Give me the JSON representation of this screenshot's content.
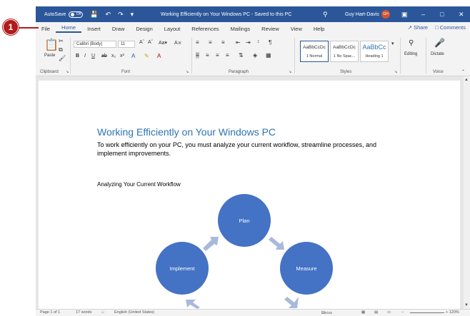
{
  "callout": {
    "number": "1"
  },
  "titlebar": {
    "autosave_label": "AutoSave",
    "autosave_state": "Off",
    "doc_title": "Working Efficiently on Your Windows PC  -  Saved to this PC",
    "user_name": "Guy Hart-Davis",
    "avatar_initials": "GH"
  },
  "tabs": [
    {
      "label": "File"
    },
    {
      "label": "Home"
    },
    {
      "label": "Insert"
    },
    {
      "label": "Draw"
    },
    {
      "label": "Design"
    },
    {
      "label": "Layout"
    },
    {
      "label": "References"
    },
    {
      "label": "Mailings"
    },
    {
      "label": "Review"
    },
    {
      "label": "View"
    },
    {
      "label": "Help"
    }
  ],
  "tab_actions": {
    "share": "Share",
    "comments": "Comments"
  },
  "ribbon": {
    "clipboard": {
      "label": "Clipboard",
      "paste": "Paste"
    },
    "font": {
      "label": "Font",
      "family": "Calibri (Body)",
      "size": "11"
    },
    "paragraph": {
      "label": "Paragraph"
    },
    "styles": {
      "label": "Styles",
      "items": [
        {
          "sample": "AaBbCcDc",
          "name": "1 Normal"
        },
        {
          "sample": "AaBbCcDc",
          "name": "1 No Spac..."
        },
        {
          "sample": "AaBbCc",
          "name": "Heading 1"
        }
      ]
    },
    "editing": {
      "label": "Editing"
    },
    "voice": {
      "label": "Voice",
      "dictate": "Dictate"
    }
  },
  "document": {
    "heading": "Working Efficiently on Your Windows PC",
    "body_line1": "To work efficiently on your PC, you must analyze your current workflow, streamline processes, and",
    "body_line2": "implement improvements.",
    "subheading": "Analyzing Your Current Workflow",
    "cycle": {
      "plan": "Plan",
      "measure": "Measure",
      "implement": "Implement"
    }
  },
  "statusbar": {
    "page": "Page 1 of 1",
    "words": "17 words",
    "language": "English (United States)",
    "focus": "Focus",
    "zoom": "+ 120%"
  },
  "colors": {
    "brand": "#2b579a",
    "smartart": "#4472c4",
    "heading": "#2e74b5",
    "callout": "#b01b1b"
  }
}
